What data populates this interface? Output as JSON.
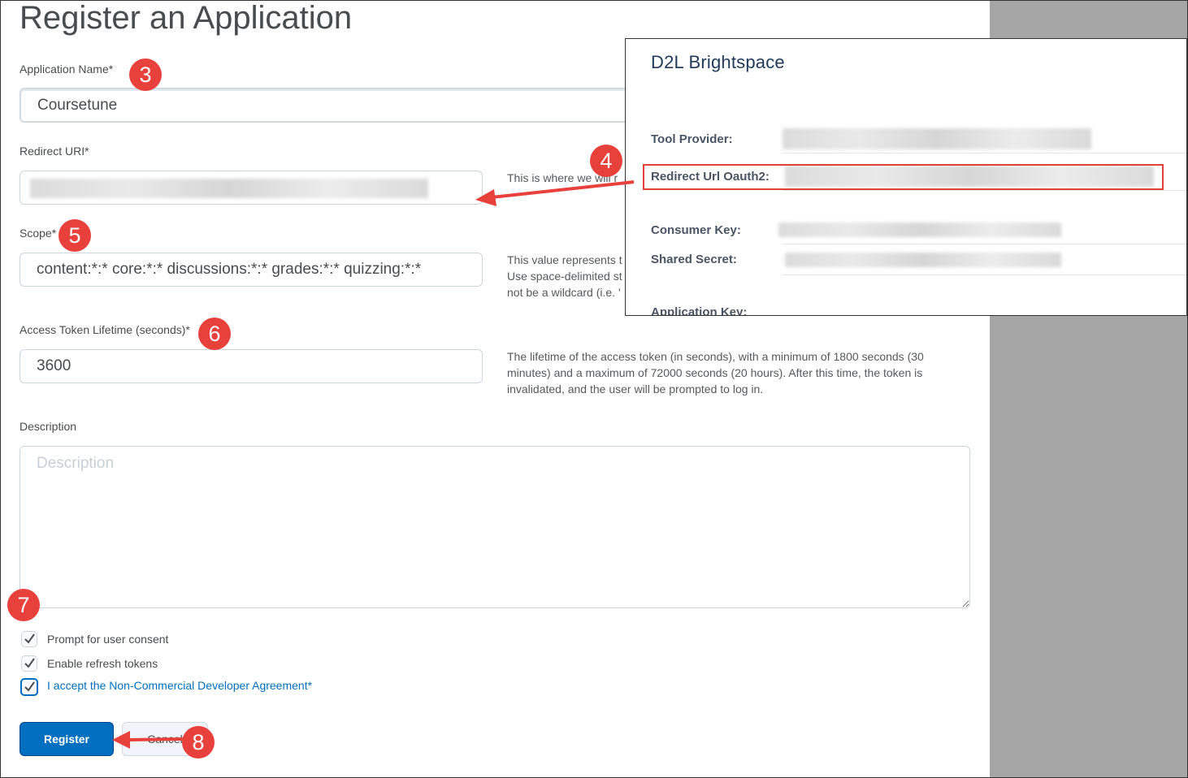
{
  "form": {
    "title": "Register an Application",
    "app_name_label": "Application Name*",
    "app_name_value": "Coursetune",
    "redirect_label": "Redirect URI*",
    "redirect_help": "This is where we will r",
    "scope_label": "Scope*",
    "scope_value": "content:*:* core:*:* discussions:*:* grades:*:* quizzing:*:*",
    "scope_help_1": "This value represents t",
    "scope_help_2": "Use space-delimited st",
    "scope_help_3": "not be a wildcard (i.e. '",
    "token_label": "Access Token Lifetime (seconds)*",
    "token_value": "3600",
    "token_help": "The lifetime of the access token (in seconds), with a minimum of 1800 seconds (30 minutes) and a maximum of 72000 seconds (20 hours). After this time, the token is invalidated, and the user will be prompted to log in.",
    "description_label": "Description",
    "description_placeholder": "Description",
    "checkboxes": [
      {
        "label": "Prompt for user consent",
        "checked": true
      },
      {
        "label": "Enable refresh tokens",
        "checked": true
      },
      {
        "label": "I accept the Non-Commercial Developer Agreement*",
        "checked": true
      }
    ],
    "register_label": "Register",
    "cancel_label": "Cancel"
  },
  "popup": {
    "title": "D2L Brightspace",
    "tool_provider_label": "Tool Provider:",
    "redirect_url_label": "Redirect Url Oauth2:",
    "consumer_key_label": "Consumer Key:",
    "shared_secret_label": "Shared Secret:",
    "application_key_label": "Application Key:"
  },
  "markers": [
    "3",
    "4",
    "5",
    "6",
    "7",
    "8"
  ],
  "colors": {
    "marker": "#e8413c",
    "primary": "#006fbf",
    "highlight_box": "#e3403a",
    "side_panel": "#a6a6a6"
  }
}
